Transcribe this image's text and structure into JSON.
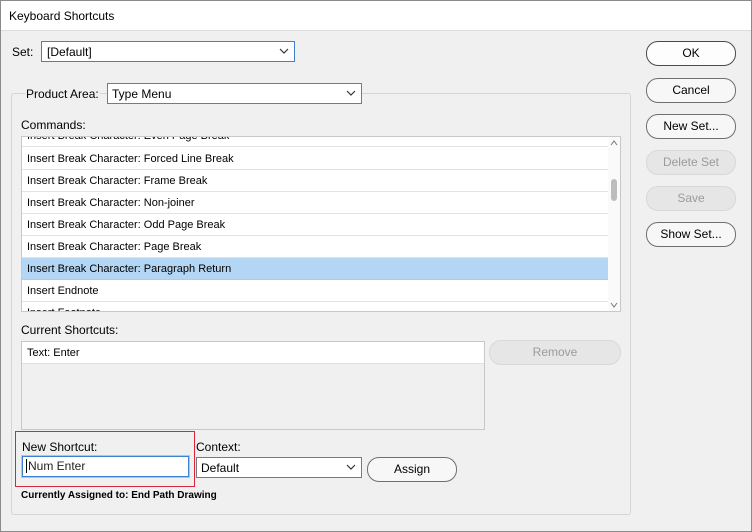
{
  "window": {
    "title": "Keyboard Shortcuts"
  },
  "set": {
    "label": "Set:",
    "value": "[Default]"
  },
  "product_area": {
    "label": "Product Area:",
    "value": "Type Menu"
  },
  "commands": {
    "label": "Commands:",
    "items": [
      "Insert Break Character: Even Page Break",
      "Insert Break Character: Forced Line Break",
      "Insert Break Character: Frame Break",
      "Insert Break Character: Non-joiner",
      "Insert Break Character: Odd Page Break",
      "Insert Break Character: Page Break",
      "Insert Break Character: Paragraph Return",
      "Insert Endnote",
      "Insert Footnote"
    ],
    "selected_index": 6
  },
  "current_shortcuts": {
    "label": "Current Shortcuts:",
    "items": [
      "Text: Enter"
    ]
  },
  "remove_button": "Remove",
  "new_shortcut": {
    "label": "New Shortcut:",
    "value": "Num Enter"
  },
  "context": {
    "label": "Context:",
    "value": "Default"
  },
  "assign_button": "Assign",
  "currently_assigned": "Currently Assigned to: End Path Drawing",
  "buttons": {
    "ok": "OK",
    "cancel": "Cancel",
    "new_set": "New Set...",
    "delete_set": "Delete Set",
    "save": "Save",
    "show_set": "Show Set..."
  },
  "colors": {
    "selection": "#b4d6f5",
    "focus_border": "#3c82d2",
    "highlight_border": "#d7263d"
  }
}
